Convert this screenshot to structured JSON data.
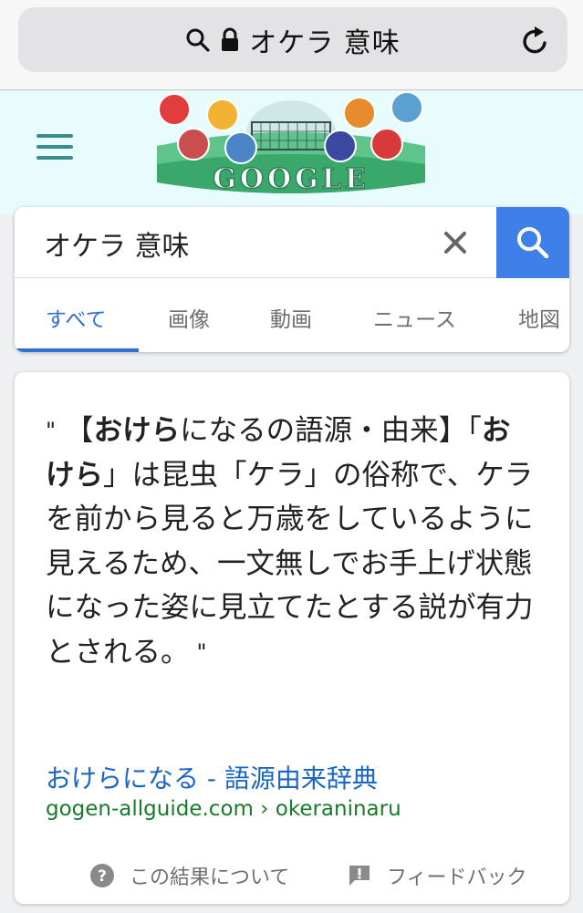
{
  "browser": {
    "url_text": "オケラ 意味",
    "search_icon": "search-icon",
    "lock_icon": "lock-icon",
    "reload_icon": "reload-icon"
  },
  "header": {
    "menu_icon": "hamburger-icon",
    "logo_text": "GOOGLE"
  },
  "search": {
    "query": "オケラ 意味",
    "clear_icon": "close-icon",
    "submit_icon": "search-icon"
  },
  "tabs": [
    {
      "label": "すべて",
      "active": true
    },
    {
      "label": "画像",
      "active": false
    },
    {
      "label": "動画",
      "active": false
    },
    {
      "label": "ニュース",
      "active": false
    },
    {
      "label": "地図",
      "active": false
    }
  ],
  "result": {
    "quote_open": "\"",
    "quote_bracket_open": "【",
    "quote_bold_1": "おけら",
    "quote_text_1": "になるの語源・由来】",
    "quote_text_2": "「",
    "quote_bold_2": "おけら",
    "quote_text_3": "」は昆虫「ケラ」の俗称で、ケラを前から見ると万歳をしているように見えるため、一文無しでお手上げ状態になった姿に見立てたとする説が有力とされる。",
    "quote_close": "\"",
    "source_title": "おけらになる - 語源由来辞典",
    "source_url": "gogen-allguide.com › okeraninaru",
    "about_label": "この結果について",
    "feedback_label": "フィードバック"
  },
  "colors": {
    "accent_blue": "#3e7fe8",
    "link_blue": "#1a66c8",
    "url_green": "#197a2a",
    "header_bg": "#e9fcfd"
  }
}
